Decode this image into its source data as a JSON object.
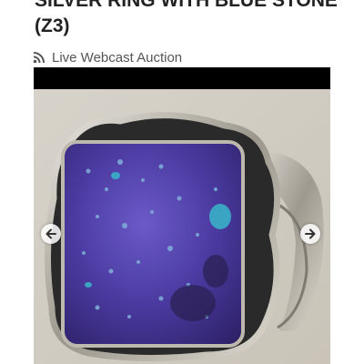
{
  "item": {
    "title": "SILVER RING WITH BLUE STONE (Z3)"
  },
  "auction": {
    "type_label": "Live Webcast Auction",
    "icon": "rss-icon"
  },
  "gallery": {
    "prev_icon": "arrow-left-icon",
    "next_icon": "arrow-right-icon"
  },
  "colors": {
    "title": "#222222",
    "meta_text": "#555555",
    "gallery_bar": "#000000"
  }
}
